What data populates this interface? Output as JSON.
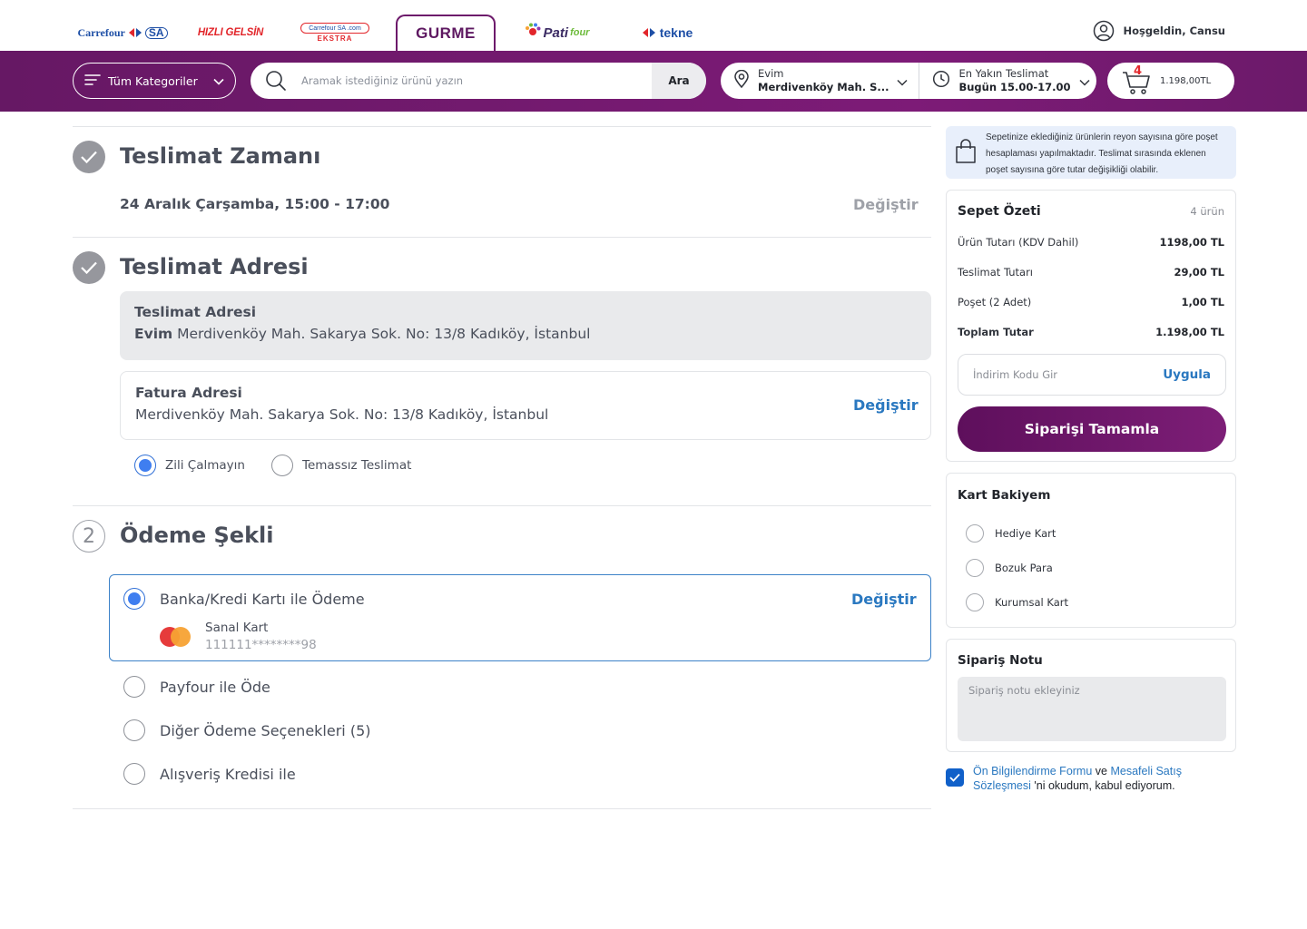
{
  "brands": {
    "carrefoursa": "Carrefour",
    "carrefoursa_sa": "SA",
    "hizli_gelsin": "HIZLI GELSİN",
    "ekstra_top": "Carrefour SA .com",
    "ekstra": "EKSTRA",
    "gurme": "GURME",
    "pati": "Pati",
    "pati_four": "four",
    "tekne": "tekne"
  },
  "header": {
    "greeting": "Hoşgeldin, Cansu"
  },
  "nav": {
    "categories_label": "Tüm Kategoriler",
    "search_placeholder": "Aramak istediğiniz ürünü yazın",
    "search_button": "Ara",
    "address_label": "Evim",
    "address_value": "Merdivenköy Mah. S...",
    "delivery_label": "En Yakın Teslimat",
    "delivery_value": "Bugün 15.00-17.00",
    "cart_count": "4",
    "cart_amount": "1.198,00TL"
  },
  "delivery_time": {
    "title": "Teslimat Zamanı",
    "slot": "24 Aralık Çarşamba, 15:00 - 17:00",
    "change": "Değiştir"
  },
  "delivery_address": {
    "title": "Teslimat Adresi",
    "card_title": "Teslimat Adresi",
    "address_name": "Evim",
    "address_text": "Merdivenköy Mah. Sakarya Sok. No: 13/8 Kadıköy, İstanbul",
    "invoice_title": "Fatura Adresi",
    "invoice_text": "Merdivenköy Mah. Sakarya Sok. No: 13/8 Kadıköy, İstanbul",
    "invoice_change": "Değiştir",
    "options": [
      {
        "label": "Zili Çalmayın",
        "selected": true
      },
      {
        "label": "Temassız Teslimat",
        "selected": false
      }
    ]
  },
  "payment": {
    "step": "2",
    "title": "Ödeme Şekli",
    "selected_label": "Banka/Kredi Kartı ile Ödeme",
    "change": "Değiştir",
    "card_name": "Sanal Kart",
    "card_number": "111111********98",
    "options": [
      {
        "label": "Payfour ile Öde"
      },
      {
        "label": "Diğer Ödeme Seçenekleri (5)"
      },
      {
        "label": "Alışveriş Kredisi ile"
      }
    ]
  },
  "info_banner": "Sepetinize eklediğiniz ürünlerin reyon sayısına göre poşet hesaplaması yapılmaktadır. Teslimat sırasında eklenen poşet sayısına göre tutar değişikliği olabilir.",
  "summary": {
    "title": "Sepet Özeti",
    "count": "4 ürün",
    "rows": [
      {
        "label": "Ürün Tutarı (KDV Dahil)",
        "value": "1198,00 TL"
      },
      {
        "label": "Teslimat Tutarı",
        "value": "29,00 TL"
      },
      {
        "label": "Poşet (2 Adet)",
        "value": "1,00 TL"
      },
      {
        "label": "Toplam Tutar",
        "value": "1.198,00 TL"
      }
    ],
    "coupon_placeholder": "İndirim Kodu Gir",
    "coupon_apply": "Uygula",
    "cta": "Siparişi Tamamla"
  },
  "balance": {
    "title": "Kart Bakiyem",
    "items": [
      "Hediye Kart",
      "Bozuk Para",
      "Kurumsal Kart"
    ]
  },
  "note": {
    "title": "Sipariş Notu",
    "placeholder": "Sipariş notu ekleyiniz"
  },
  "agreement": {
    "link1": "Ön Bilgilendirme Formu",
    "and": " ve ",
    "link2": "Mesafeli Satış Sözleşmesi",
    "rest": " 'ni okudum, kabul ediyorum.",
    "checked": true
  },
  "colors": {
    "brand_purple": "#6d1a6b",
    "link_blue": "#2a78c0",
    "radio_blue": "#3f7ef0"
  }
}
